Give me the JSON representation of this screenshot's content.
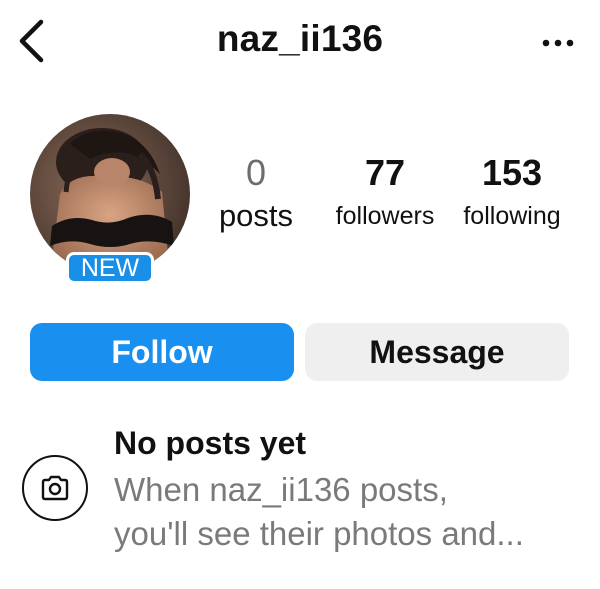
{
  "header": {
    "back_icon": "chevron-left-icon",
    "username": "naz_ii136",
    "more_icon": "more-horizontal-icon"
  },
  "profile": {
    "avatar": "profile-photo",
    "badge": "NEW",
    "stats": {
      "posts": {
        "value": "0",
        "label": "posts"
      },
      "followers": {
        "value": "77",
        "label": "followers"
      },
      "following": {
        "value": "153",
        "label": "following"
      }
    }
  },
  "actions": {
    "follow_label": "Follow",
    "message_label": "Message"
  },
  "empty_state": {
    "icon": "camera-icon",
    "title": "No posts yet",
    "line1": "When naz_ii136 posts,",
    "line2": "you'll see their photos and..."
  },
  "colors": {
    "accent": "#1990f0",
    "badge": "#1a8fe8",
    "secondary_button": "#efefef",
    "muted_text": "#7a7a7a"
  }
}
